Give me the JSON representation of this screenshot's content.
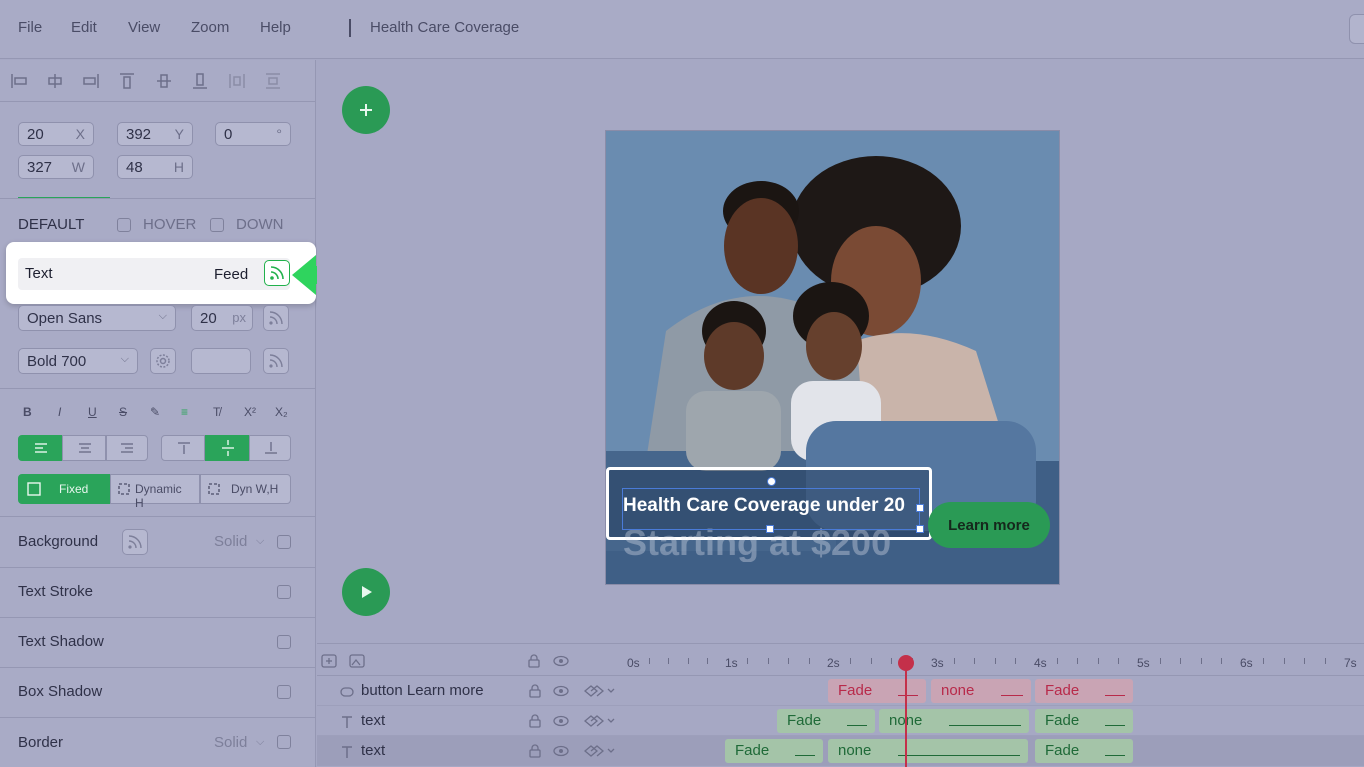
{
  "menu": {
    "file": "File",
    "edit": "Edit",
    "view": "View",
    "zoom": "Zoom",
    "help": "Help"
  },
  "document_title": "Health Care Coverage",
  "transform": {
    "x": "20",
    "x_suffix": "X",
    "y": "392",
    "y_suffix": "Y",
    "rotation": "0",
    "rotation_suffix": "°",
    "w": "327",
    "w_suffix": "W",
    "h": "48",
    "h_suffix": "H"
  },
  "states": {
    "default": "DEFAULT",
    "hover": "HOVER",
    "down": "DOWN"
  },
  "feed_row": {
    "label": "Text",
    "feed_label": "Feed"
  },
  "font": {
    "family": "Open Sans",
    "size": "20",
    "size_unit": "px",
    "weight": "Bold 700"
  },
  "format": {
    "bold": "B",
    "italic": "I",
    "underline": "U",
    "strike": "S",
    "superscript": "X²",
    "subscript": "X₂"
  },
  "sizing": {
    "fixed": "Fixed",
    "dynamic_h": "Dynamic H",
    "dyn_wh": "Dyn W,H"
  },
  "properties": {
    "background": "Background",
    "background_mode": "Solid",
    "text_stroke": "Text Stroke",
    "text_shadow": "Text Shadow",
    "box_shadow": "Box Shadow",
    "border": "Border",
    "border_mode": "Solid"
  },
  "banner": {
    "headline": "Health Care Coverage under 20",
    "subline": "Starting at $200",
    "cta": "Learn more"
  },
  "timeline": {
    "ticks": [
      "0s",
      "1s",
      "2s",
      "3s",
      "4s",
      "5s",
      "6s",
      "7s"
    ],
    "playhead_seconds": 2.75,
    "layers": [
      {
        "name": "button Learn more",
        "clips": [
          "Fade",
          "none",
          "Fade"
        ]
      },
      {
        "name": "text",
        "clips": [
          "Fade",
          "none",
          "Fade"
        ]
      },
      {
        "name": "text",
        "clips": [
          "Fade",
          "none",
          "Fade"
        ]
      }
    ]
  },
  "colors": {
    "accent": "#2aa45a",
    "playhead": "#c4304a",
    "panel": "#a9abc6"
  }
}
